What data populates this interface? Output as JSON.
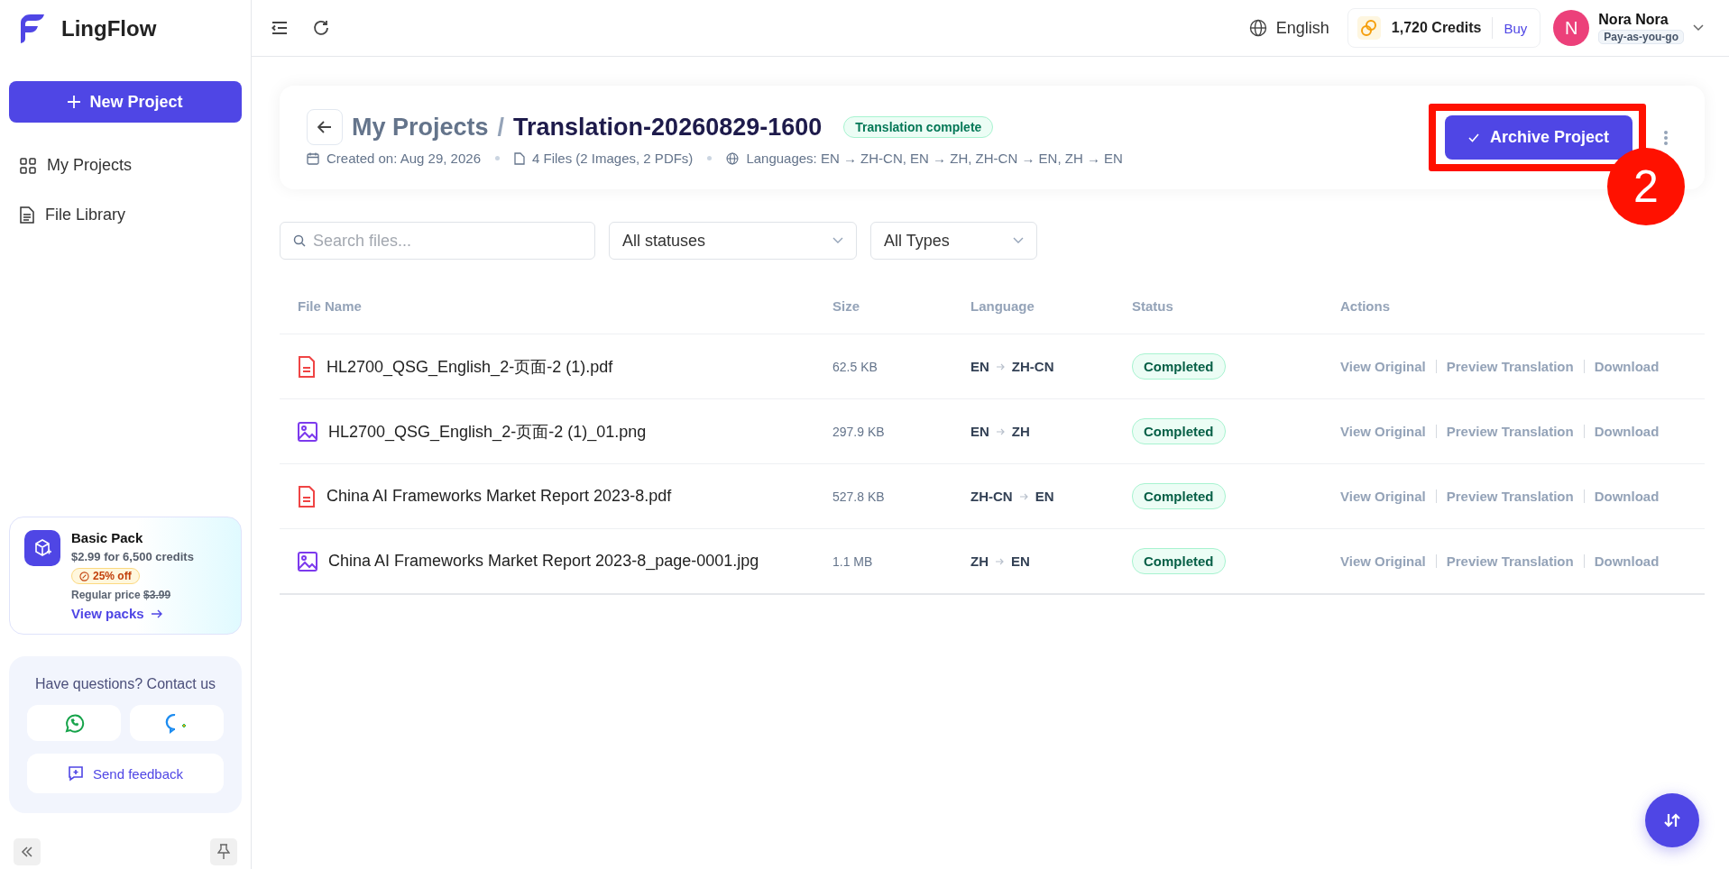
{
  "brand": {
    "name": "LingFlow"
  },
  "sidebar": {
    "new_project": "New Project",
    "items": [
      {
        "kind": "grid",
        "label": "My Projects"
      },
      {
        "kind": "doc",
        "label": "File Library"
      }
    ]
  },
  "promo": {
    "title": "Basic Pack",
    "price": "$2.99 for 6,500 credits",
    "discount": "25% off",
    "regular_label": "Regular price",
    "regular_price": "$3.99",
    "link": "View packs"
  },
  "contact": {
    "title": "Have questions? Contact us",
    "feedback": "Send feedback"
  },
  "topbar": {
    "language": "English",
    "credits": "1,720 Credits",
    "buy": "Buy",
    "user": {
      "initial": "N",
      "name": "Nora Nora",
      "plan": "Pay-as-you-go"
    }
  },
  "project": {
    "breadcrumb": "My Projects",
    "separator": "/",
    "title": "Translation-20260829-1600",
    "status": "Translation complete",
    "created": "Created on: Aug 29, 2026",
    "files": "4 Files (2 Images, 2 PDFs)",
    "languages": "Languages: EN → ZH-CN, EN → ZH, ZH-CN → EN, ZH → EN",
    "archive": "Archive Project"
  },
  "annotation": {
    "label": "2"
  },
  "filters": {
    "search_placeholder": "Search files...",
    "status": "All statuses",
    "type": "All Types"
  },
  "table": {
    "columns": [
      "File Name",
      "Size",
      "Language",
      "Status",
      "Actions"
    ],
    "rows": [
      {
        "kind": "pdf",
        "name": "HL2700_QSG_English_2-页面-2 (1).pdf",
        "size": "62.5 KB",
        "from": "EN",
        "to": "ZH-CN",
        "status": "Completed",
        "actions": [
          "View Original",
          "Preview Translation",
          "Download"
        ]
      },
      {
        "kind": "image",
        "name": "HL2700_QSG_English_2-页面-2 (1)_01.png",
        "size": "297.9 KB",
        "from": "EN",
        "to": "ZH",
        "status": "Completed",
        "actions": [
          "View Original",
          "Preview Translation",
          "Download"
        ]
      },
      {
        "kind": "pdf",
        "name": "China AI Frameworks Market Report 2023-8.pdf",
        "size": "527.8 KB",
        "from": "ZH-CN",
        "to": "EN",
        "status": "Completed",
        "actions": [
          "View Original",
          "Preview Translation",
          "Download"
        ]
      },
      {
        "kind": "image",
        "name": "China AI Frameworks Market Report 2023-8_page-0001.jpg",
        "size": "1.1 MB",
        "from": "ZH",
        "to": "EN",
        "status": "Completed",
        "actions": [
          "View Original",
          "Preview Translation",
          "Download"
        ]
      }
    ]
  }
}
